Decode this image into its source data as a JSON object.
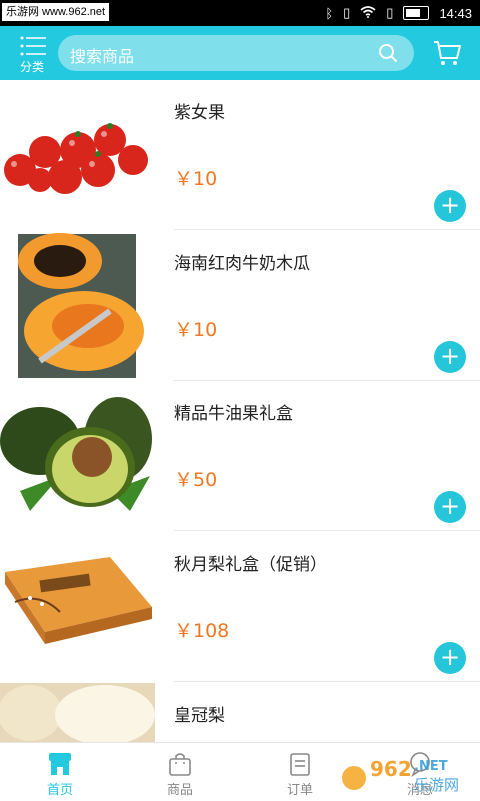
{
  "status_bar": {
    "watermark": "乐游网 www.962.net",
    "time": "14:43"
  },
  "header": {
    "category_label": "分类",
    "search_placeholder": "搜索商品",
    "accent_color": "#23c9de"
  },
  "products": [
    {
      "name": "紫女果",
      "price": "￥10"
    },
    {
      "name": "海南红肉牛奶木瓜",
      "price": "￥10"
    },
    {
      "name": "精品牛油果礼盒",
      "price": "￥50"
    },
    {
      "name": "秋月梨礼盒（促销）",
      "price": "￥108"
    },
    {
      "name": "皇冠梨",
      "price": ""
    }
  ],
  "tabbar": {
    "tabs": [
      {
        "label": "首页",
        "active": true
      },
      {
        "label": "商品",
        "active": false
      },
      {
        "label": "订单",
        "active": false
      },
      {
        "label": "消息",
        "active": false
      }
    ]
  },
  "watermark_logo": "962.NET 乐游网",
  "price_color": "#f07822"
}
